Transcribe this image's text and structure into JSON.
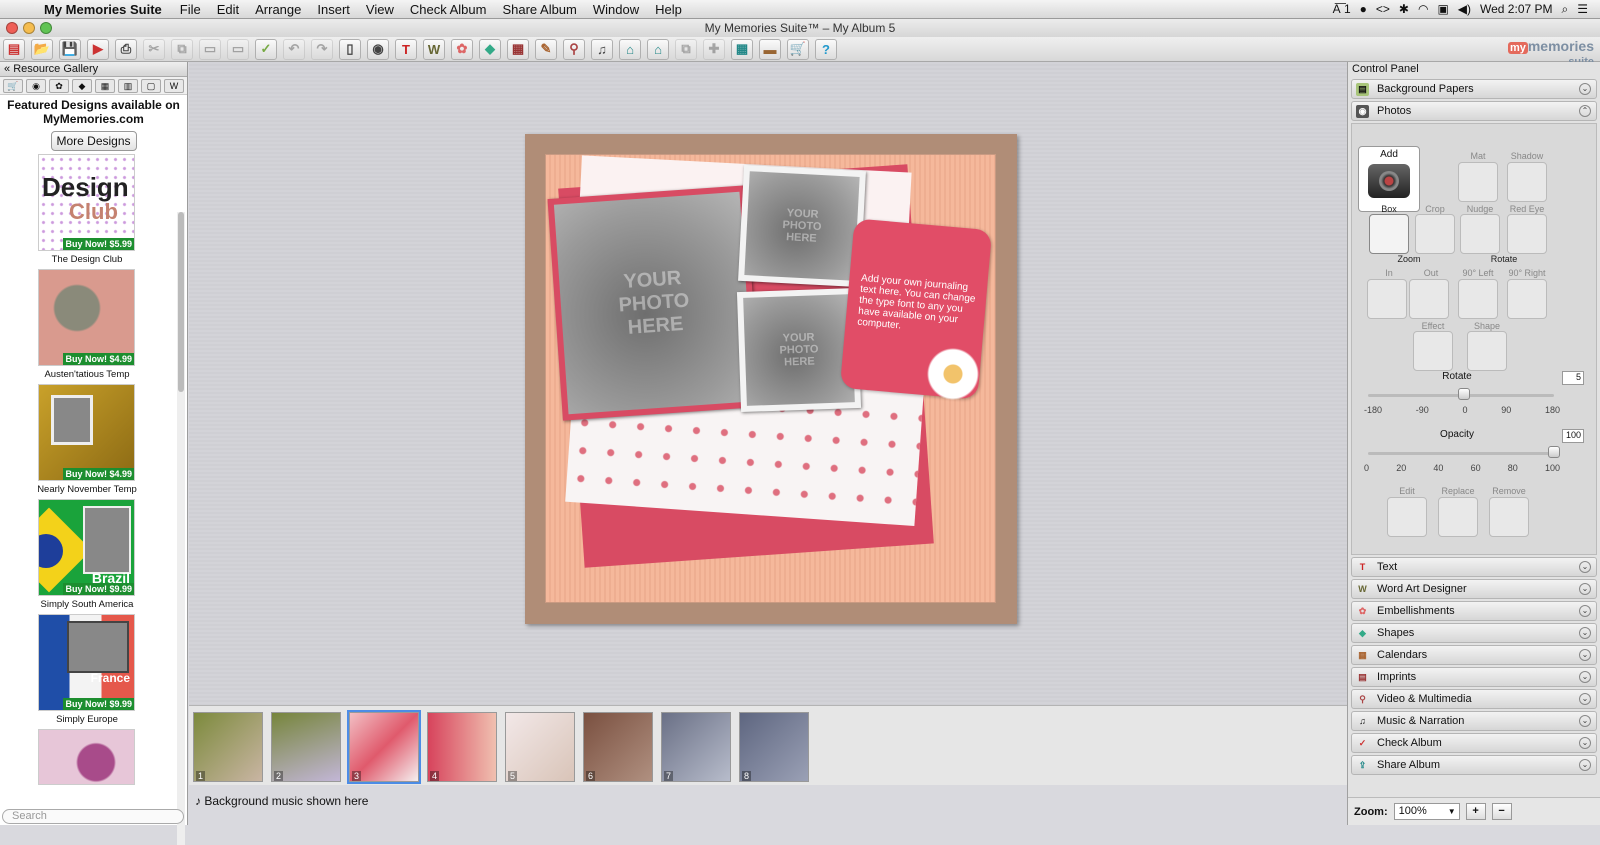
{
  "menubar": {
    "app": "My Memories Suite",
    "items": [
      "File",
      "Edit",
      "Arrange",
      "Insert",
      "View",
      "Check Album",
      "Share Album",
      "Window",
      "Help"
    ],
    "status_input": "1",
    "clock": "Wed 2:07 PM"
  },
  "window": {
    "title": "My Memories Suite™ – My Album 5"
  },
  "toolbar": {
    "logo_my": "my",
    "logo_rest": "memories",
    "logo_suite": "suite"
  },
  "resource_gallery": {
    "header": "Resource Gallery",
    "featured": "Featured Designs available on MyMemories.com",
    "more_designs": "More Designs",
    "items": [
      {
        "name": "The Design Club",
        "price": "Buy Now! $5.99",
        "art_line1": "Design",
        "art_line2": "Club"
      },
      {
        "name": "Austen'tatious Temp",
        "price": "Buy Now! $4.99"
      },
      {
        "name": "Nearly November Temp",
        "price": "Buy Now! $4.99"
      },
      {
        "name": "Simply South America",
        "price": "Buy Now! $9.99",
        "art": "Brazil"
      },
      {
        "name": "Simply Europe",
        "price": "Buy Now! $9.99",
        "art": "France"
      }
    ],
    "search_placeholder": "Search"
  },
  "canvas": {
    "photo_placeholder": "YOUR PHOTO HERE",
    "journal_text": "Add your own journaling text here. You can change the type font to any you have available on your computer."
  },
  "filmstrip": {
    "pages": [
      "1",
      "2",
      "3",
      "4",
      "5",
      "6",
      "7",
      "8"
    ],
    "selected": "3",
    "status": "Background music shown here"
  },
  "control_panel": {
    "title": "Control Panel",
    "sections_top": [
      "Background Papers",
      "Photos"
    ],
    "photos": {
      "add": "Add",
      "mat": "Mat",
      "shadow": "Shadow",
      "box": "Box",
      "crop": "Crop",
      "nudge": "Nudge",
      "red_eye": "Red Eye",
      "zoom": "Zoom",
      "zoom_in": "In",
      "zoom_out": "Out",
      "rotate": "Rotate",
      "rot_left": "90° Left",
      "rot_right": "90° Right",
      "effect": "Effect",
      "shape": "Shape",
      "rotate_label": "Rotate",
      "rotate_value": "5",
      "rotate_ticks": [
        "-180",
        "-90",
        "0",
        "90",
        "180"
      ],
      "opacity_label": "Opacity",
      "opacity_value": "100",
      "opacity_ticks": [
        "0",
        "20",
        "40",
        "60",
        "80",
        "100"
      ],
      "edit": "Edit",
      "replace": "Replace",
      "remove": "Remove"
    },
    "sections_bottom": [
      "Text",
      "Word Art Designer",
      "Embellishments",
      "Shapes",
      "Calendars",
      "Imprints",
      "Video & Multimedia",
      "Music & Narration",
      "Check Album",
      "Share Album"
    ],
    "zoom_label": "Zoom:",
    "zoom_value": "100%"
  },
  "colors": {
    "accent": "#4c8ce6",
    "buy_green": "#1c8e2f",
    "album_pink": "#d84b63"
  }
}
